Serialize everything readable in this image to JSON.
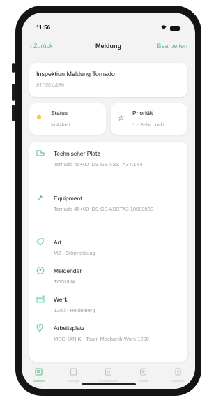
{
  "status_bar": {
    "time": "11:56",
    "location_icon": "location-arrow-icon",
    "wifi_icon": "wifi-icon",
    "battery_icon": "battery-icon"
  },
  "nav": {
    "back_label": "Zurück",
    "title": "Meldung",
    "edit_label": "Bearbeiten"
  },
  "header": {
    "title": "Inspektion Meldung Tornado",
    "id": "#10014469"
  },
  "status_card": {
    "label": "Status",
    "value": "In Arbeit",
    "icon": "status-dot-icon",
    "color": "#f2c94c"
  },
  "priority_card": {
    "label": "Priorität",
    "value": "1 - Sehr hoch",
    "icon": "double-chevron-up-icon",
    "color": "#e07a7a"
  },
  "details": [
    {
      "icon": "technical-place-icon",
      "label": "Technischer Platz",
      "value": "Tornado 45+00 IDS GS ASSTA3 A1Y4"
    },
    {
      "icon": "wrench-icon",
      "label": "Equipment",
      "value": "Tornado 45+00 IDS GS ASSTA3 10000000"
    },
    {
      "icon": "tag-icon",
      "label": "Art",
      "value": "M2 - Störmeldung"
    },
    {
      "icon": "person-icon",
      "label": "Meldender",
      "value": "TOSUUA"
    },
    {
      "icon": "factory-icon",
      "label": "Werk",
      "value": "1200 - Heidelberg"
    },
    {
      "icon": "location-pin-icon",
      "label": "Arbeitsplatz",
      "value": "MECHANIK - Team Mechanik Work 1200"
    }
  ],
  "tabs": [
    {
      "label": "Überblick",
      "icon": "overview-icon",
      "active": true
    },
    {
      "label": "Aufträge",
      "icon": "orders-icon",
      "active": false
    },
    {
      "label": "Schadensbilder",
      "icon": "damage-icon",
      "active": false
    },
    {
      "label": "Dateien",
      "icon": "files-icon",
      "active": false
    },
    {
      "label": "Checklisten",
      "icon": "checklist-icon",
      "active": false
    }
  ],
  "colors": {
    "accent": "#5dbd8a",
    "icon_green": "#6cc7a1",
    "background": "#f3f3f3"
  }
}
